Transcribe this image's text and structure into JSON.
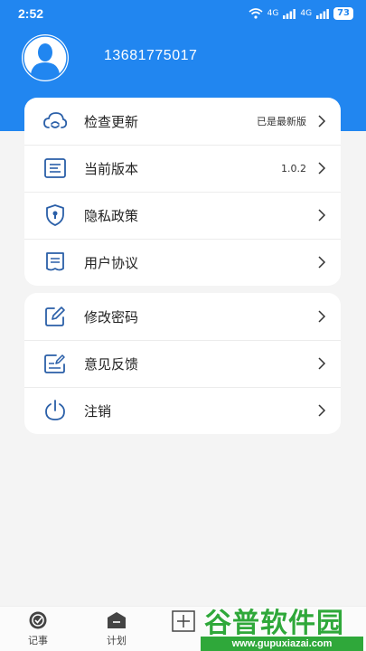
{
  "status_bar": {
    "time": "2:52",
    "signal1": "4G",
    "signal2": "4G",
    "battery": "73"
  },
  "profile": {
    "phone": "13681775017"
  },
  "menu": [
    {
      "label": "检查更新",
      "value": "已是最新版",
      "icon": "cloud-refresh-icon"
    },
    {
      "label": "当前版本",
      "value": "1.0.2",
      "icon": "document-list-icon"
    },
    {
      "label": "隐私政策",
      "value": "",
      "icon": "shield-keyhole-icon"
    },
    {
      "label": "用户协议",
      "value": "",
      "icon": "agreement-doc-icon"
    }
  ],
  "menu2": [
    {
      "label": "修改密码",
      "icon": "edit-pencil-icon"
    },
    {
      "label": "意见反馈",
      "icon": "feedback-edit-icon"
    },
    {
      "label": "注销",
      "icon": "power-icon"
    }
  ],
  "nav": {
    "notes": "记事",
    "plan": "计划"
  },
  "watermark": {
    "title": "谷普软件园",
    "url": "www.gupuxiazai.com"
  },
  "colors": {
    "brand": "#2186f0",
    "watermark": "#2fa83a"
  }
}
